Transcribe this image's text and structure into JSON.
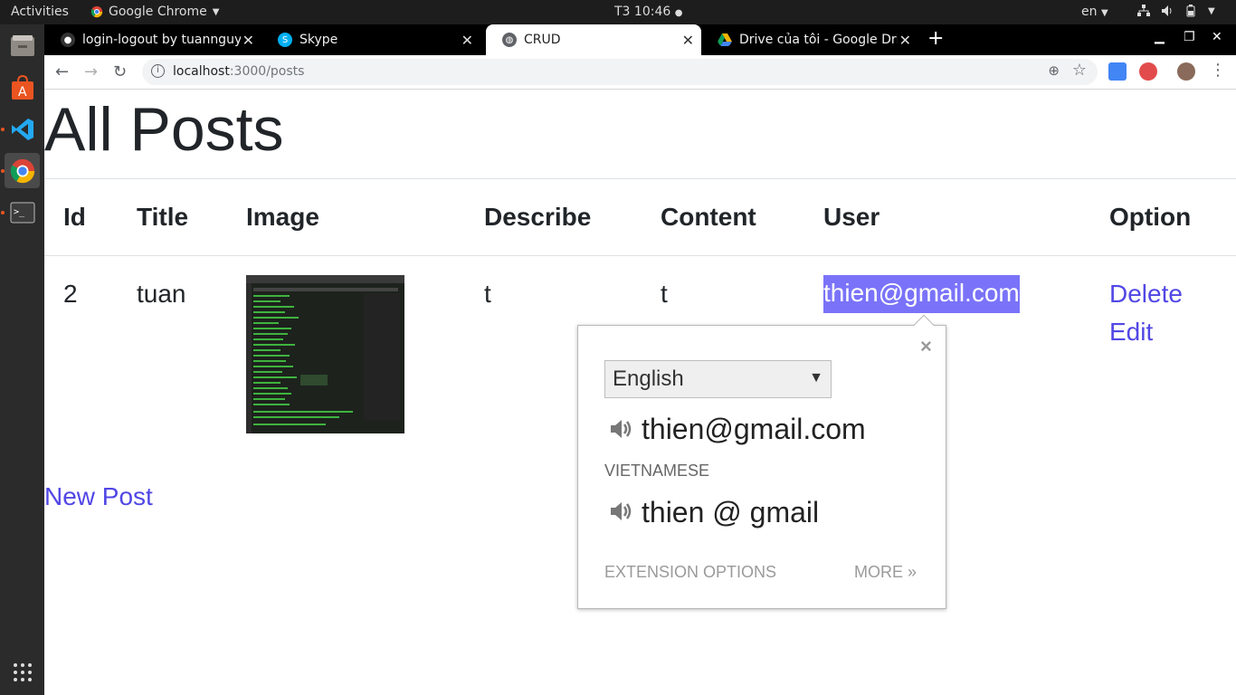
{
  "system_bar": {
    "activities": "Activities",
    "app_name": "Google Chrome",
    "clock": "T3 10:46",
    "language": "en"
  },
  "dock": {
    "items": [
      "files-icon",
      "software-store-icon",
      "vscode-icon",
      "chrome-icon",
      "terminal-icon",
      "app-grid-icon"
    ]
  },
  "browser": {
    "tabs": [
      {
        "label": "login-logout by tuannguy",
        "icon": "github-icon"
      },
      {
        "label": "Skype",
        "icon": "skype-icon"
      },
      {
        "label": "CRUD",
        "icon": "globe-icon"
      },
      {
        "label": "Drive của tôi - Google Dri",
        "icon": "drive-icon"
      }
    ],
    "close_glyph": "✕",
    "new_tab_glyph": "+",
    "url_host": "localhost",
    "url_path": ":3000/posts"
  },
  "page": {
    "title": "All Posts",
    "table": {
      "headers": [
        "Id",
        "Title",
        "Image",
        "Describe",
        "Content",
        "User",
        "Option"
      ],
      "rows": [
        {
          "id": "2",
          "title": "tuan",
          "describe": "t",
          "content": "t",
          "user": "thien@gmail.com",
          "options": [
            "Delete",
            "Edit"
          ]
        }
      ]
    },
    "new_post": "New Post"
  },
  "dictionary_popup": {
    "close": "×",
    "language": "English",
    "word": "thien@gmail.com",
    "second_language": "VIETNAMESE",
    "translation": "thien @ gmail",
    "extension_options": "EXTENSION OPTIONS",
    "more": "MORE »"
  },
  "colors": {
    "link": "#5147e5",
    "selection": "#7a73f9",
    "chrome_tabstrip": "#000000",
    "ubuntu_accent": "#e95420"
  }
}
